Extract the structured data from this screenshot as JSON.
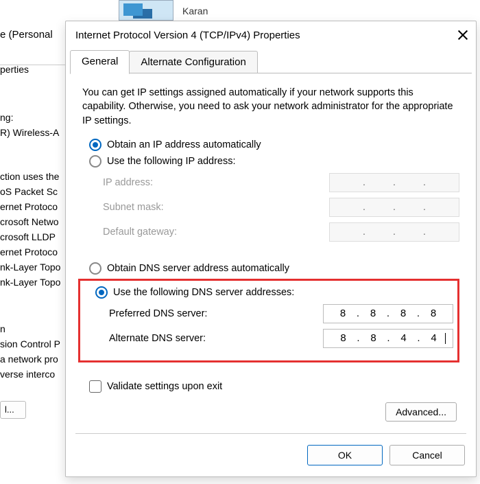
{
  "background": {
    "top_label": "Karan",
    "lhs": {
      "title_fragment": "e (Personal",
      "perties": "perties",
      "ng": "ng:",
      "wireless": "R) Wireless-A",
      "uses": "ction uses the",
      "items": [
        "oS Packet Sc",
        "ernet Protoco",
        "crosoft Netwo",
        "crosoft LLDP",
        "ernet Protoco",
        "nk-Layer Topo",
        "nk-Layer Topo"
      ],
      "install_btn": "l...",
      "n": "n",
      "desc1": "sion Control P",
      "desc2": "a network pro",
      "desc3": "verse interco"
    }
  },
  "dialog": {
    "title": "Internet Protocol Version 4 (TCP/IPv4) Properties",
    "tabs": {
      "general": "General",
      "alternate": "Alternate Configuration"
    },
    "intro": "You can get IP settings assigned automatically if your network supports this capability. Otherwise, you need to ask your network administrator for the appropriate IP settings.",
    "ip": {
      "obtain_auto": "Obtain an IP address automatically",
      "use_following": "Use the following IP address:",
      "ip_address_label": "IP address:",
      "subnet_label": "Subnet mask:",
      "gateway_label": "Default gateway:"
    },
    "dns": {
      "obtain_auto": "Obtain DNS server address automatically",
      "use_following": "Use the following DNS server addresses:",
      "preferred_label": "Preferred DNS server:",
      "alternate_label": "Alternate DNS server:",
      "preferred_value": [
        "8",
        "8",
        "8",
        "8"
      ],
      "alternate_value": [
        "8",
        "8",
        "4",
        "4"
      ]
    },
    "validate_label": "Validate settings upon exit",
    "advanced_btn": "Advanced...",
    "ok_btn": "OK",
    "cancel_btn": "Cancel"
  }
}
